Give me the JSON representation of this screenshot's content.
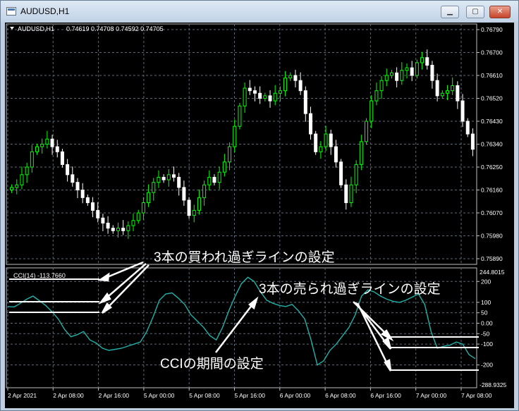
{
  "window": {
    "title": "AUDUSD,H1",
    "minimize_label": "▁",
    "maximize_label": "▢",
    "close_label": "✕"
  },
  "chart_header": {
    "symbol_tf": "AUDUSD,H1",
    "ohlc": "0.74619 0.74708 0.74592 0.74705"
  },
  "price_axis": [
    "0.76790",
    "0.76700",
    "0.76610",
    "0.76520",
    "0.76430",
    "0.76340",
    "0.76250",
    "0.76160",
    "0.76070",
    "0.75980",
    "0.75890"
  ],
  "cci_axis": {
    "top": "244.8015",
    "ticks": [
      "200",
      "100",
      "50",
      "0.00",
      "-50",
      "-100",
      "-200"
    ],
    "bottom": "-288.9325"
  },
  "cci_label": "CCI(14) -113.7660",
  "time_axis": [
    "2 Apr 2021",
    "2 Apr 08:00",
    "2 Apr 16:00",
    "5 Apr 00:00",
    "5 Apr 08:00",
    "5 Apr 16:00",
    "6 Apr 00:00",
    "6 Apr 08:00",
    "6 Apr 16:00",
    "7 Apr 00:00",
    "7 Apr 08:00"
  ],
  "annotations": {
    "overbought": "3本の買われ過ぎラインの設定",
    "oversold": "3本の売られ過ぎラインの設定",
    "period": "CCIの期間の設定"
  },
  "colors": {
    "bull": "#00ff00",
    "bear": "#ffffff",
    "cci": "#20b2aa",
    "grid": "#5a6a7a",
    "background": "#000000"
  },
  "chart_data": [
    {
      "type": "candlestick",
      "title": "AUDUSD,H1",
      "ylim": [
        0.7589,
        0.7679
      ],
      "close": [
        0.7617,
        0.7618,
        0.7622,
        0.7625,
        0.7631,
        0.7633,
        0.7634,
        0.7636,
        0.7633,
        0.7631,
        0.7626,
        0.7622,
        0.7619,
        0.7616,
        0.7613,
        0.7611,
        0.7608,
        0.7605,
        0.7603,
        0.7601,
        0.76,
        0.7601,
        0.76,
        0.7602,
        0.7604,
        0.7607,
        0.7611,
        0.7615,
        0.7619,
        0.7621,
        0.762,
        0.7622,
        0.7621,
        0.7617,
        0.7612,
        0.7606,
        0.7608,
        0.7613,
        0.7618,
        0.7621,
        0.7619,
        0.7623,
        0.7627,
        0.7633,
        0.7641,
        0.7649,
        0.7656,
        0.7655,
        0.7654,
        0.7652,
        0.7653,
        0.7651,
        0.7654,
        0.7655,
        0.766,
        0.7661,
        0.7659,
        0.7655,
        0.7646,
        0.7638,
        0.7631,
        0.7633,
        0.7638,
        0.7633,
        0.7627,
        0.7618,
        0.7611,
        0.7618,
        0.7626,
        0.7635,
        0.7643,
        0.7651,
        0.7655,
        0.7659,
        0.7661,
        0.7662,
        0.7659,
        0.7663,
        0.7664,
        0.7661,
        0.7666,
        0.7668,
        0.7665,
        0.7659,
        0.7653,
        0.7654,
        0.7655,
        0.7657,
        0.7651,
        0.7643,
        0.7638,
        0.7632
      ],
      "series": [
        {
          "name": "CCI(14)",
          "values": [
            80,
            78,
            95,
            115,
            130,
            108,
            85,
            55,
            20,
            -30,
            -65,
            -55,
            -40,
            -80,
            -95,
            -120,
            -130,
            -125,
            -120,
            -110,
            -100,
            -90,
            -40,
            30,
            110,
            140,
            145,
            120,
            90,
            40,
            10,
            -20,
            -60,
            -80,
            -20,
            60,
            130,
            190,
            220,
            200,
            150,
            110,
            95,
            85,
            80,
            90,
            60,
            20,
            -80,
            -200,
            -180,
            -130,
            -100,
            -60,
            -20,
            40,
            130,
            160,
            150,
            130,
            115,
            105,
            100,
            110,
            125,
            140,
            90,
            -40,
            -120,
            -110,
            -105,
            -90,
            -100,
            -150,
            -170
          ]
        }
      ]
    }
  ]
}
